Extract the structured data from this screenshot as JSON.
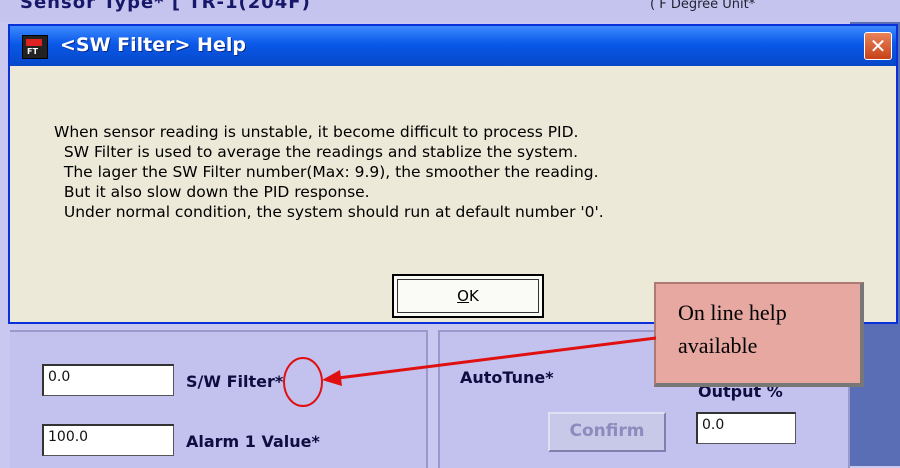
{
  "background": {
    "top_left_text": "Sensor Type* [ TR-1(204F)",
    "top_right_text": "( F Degree Unit*",
    "sw_filter_value": "0.0",
    "sw_filter_label": "S/W Filter*",
    "alarm1_value": "100.0",
    "alarm1_label": "Alarm 1 Value*",
    "autotune_label": "AutoTune*",
    "output_label": "Output %",
    "confirm_label": "Confirm",
    "output_value": "0.0"
  },
  "dialog": {
    "title": "<SW Filter> Help",
    "icon_text": "FT",
    "close_glyph": "✕",
    "message": [
      "When sensor reading is unstable, it become difficult to process PID.",
      "  SW Filter is used to average the readings and stablize the system.",
      "  The lager the SW Filter number(Max: 9.9), the smoother the reading.",
      "  But it also slow down the PID response.",
      "  Under normal condition, the system should run at default number '0'."
    ],
    "ok_label": "OK"
  },
  "callout": {
    "line1": "On line help",
    "line2": "available"
  },
  "colors": {
    "arrow": "#e01010",
    "callout_fill": "#e6a8a0"
  }
}
